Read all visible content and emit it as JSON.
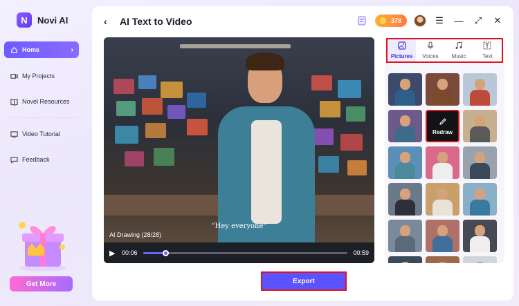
{
  "brand": {
    "logo_letter": "N",
    "name": "Novi AI"
  },
  "sidebar": {
    "items": [
      {
        "label": "Home",
        "icon": "home-icon",
        "active": true
      },
      {
        "label": "My Projects",
        "icon": "video-camera-icon",
        "active": false
      },
      {
        "label": "Novel Resources",
        "icon": "book-icon",
        "active": false
      },
      {
        "label": "Video Tutorial",
        "icon": "tutorial-icon",
        "active": false
      },
      {
        "label": "Feedback",
        "icon": "chat-icon",
        "active": false
      }
    ],
    "get_more_label": "Get More"
  },
  "header": {
    "back_glyph": "‹",
    "title": "AI Text to Video",
    "credits": "378"
  },
  "window_icons": [
    "task-icon",
    "coin-icon",
    "avatar",
    "menu-icon",
    "minimize-icon",
    "expand-icon",
    "close-icon"
  ],
  "video": {
    "subtitle": "\"Hey everyone\"",
    "ai_label": "AI Drawing",
    "ai_count": "(28/28)",
    "current_time": "00:06",
    "duration": "00:59",
    "progress": 0.11
  },
  "export_label": "Export",
  "side_panel": {
    "tabs": [
      {
        "label": "Pictures",
        "icon": "picture-icon",
        "active": true
      },
      {
        "label": "Voices",
        "icon": "microphone-icon",
        "active": false
      },
      {
        "label": "Music",
        "icon": "music-icon",
        "active": false
      },
      {
        "label": "Text",
        "icon": "text-icon",
        "active": false
      }
    ],
    "redraw_label": "Redraw"
  },
  "colors": {
    "accent": "#5a53ff",
    "highlight_border": "#e0141e",
    "credits": "#ff8c3d"
  }
}
